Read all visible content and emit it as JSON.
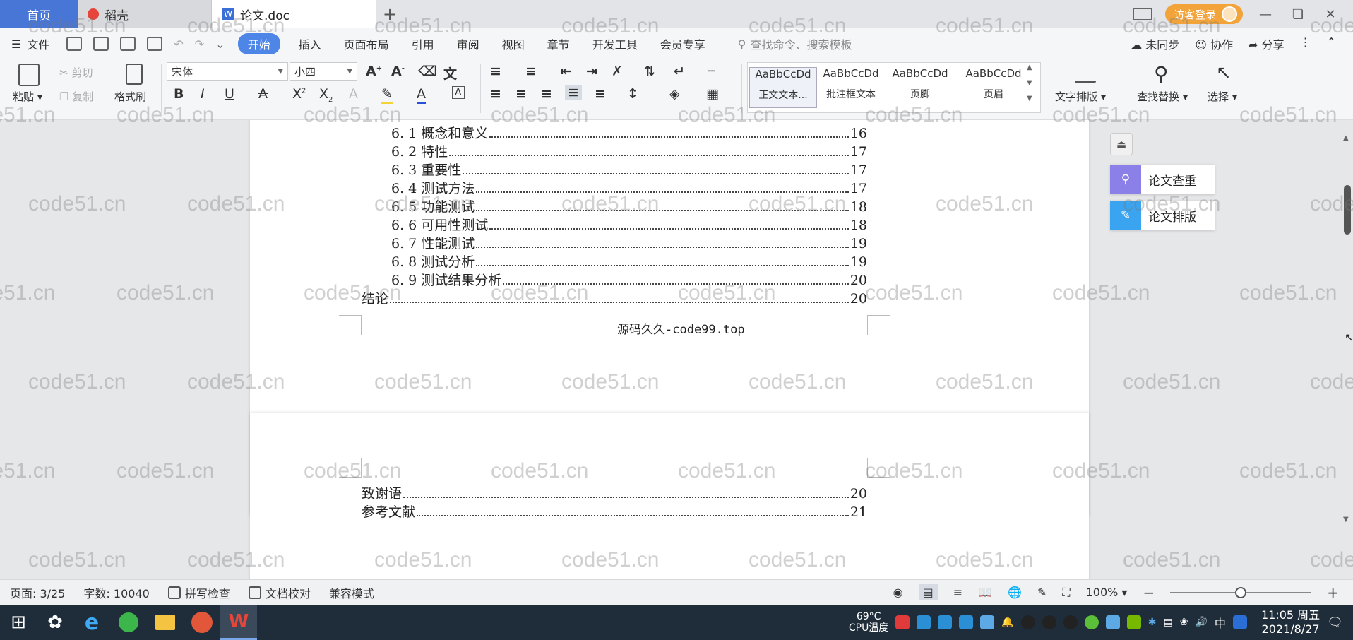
{
  "titlebar": {
    "tab_home": "首页",
    "tab_daoke": "稻壳",
    "tab_doc": "论文.doc",
    "tab_add": "+",
    "login": "访客登录"
  },
  "menu": {
    "file": "文件",
    "items": [
      "开始",
      "插入",
      "页面布局",
      "引用",
      "审阅",
      "视图",
      "章节",
      "开发工具",
      "会员专享"
    ],
    "search_placeholder": "查找命令、搜索模板",
    "right": [
      "未同步",
      "协作",
      "分享"
    ]
  },
  "ribbon": {
    "paste": "粘贴",
    "cut": "剪切",
    "copy": "复制",
    "format_painter": "格式刷",
    "font_name": "宋体",
    "font_size": "小四",
    "styles": [
      {
        "preview": "AaBbCcDd",
        "name": "正文文本..."
      },
      {
        "preview": "AaBbCcDd",
        "name": "批注框文本"
      },
      {
        "preview": "AaBbCcDd",
        "name": "页脚"
      },
      {
        "preview": "AaBbCcDd",
        "name": "页眉"
      }
    ],
    "text_layout": "文字排版",
    "find_replace": "查找替换",
    "select": "选择"
  },
  "document": {
    "toc_page1": [
      {
        "label": "6. 1 概念和意义",
        "page": "16"
      },
      {
        "label": "6. 2 特性",
        "page": "17"
      },
      {
        "label": "6. 3 重要性",
        "page": "17"
      },
      {
        "label": "6. 4 测试方法",
        "page": "17"
      },
      {
        "label": "6. 5  功能测试",
        "page": "18"
      },
      {
        "label": "6. 6 可用性测试",
        "page": "18"
      },
      {
        "label": "6. 7 性能测试",
        "page": "19"
      },
      {
        "label": "6. 8 测试分析",
        "page": "19"
      },
      {
        "label": "6. 9 测试结果分析",
        "page": "20"
      },
      {
        "label": "结论",
        "page": "20"
      }
    ],
    "footer": "源码久久-code99.top",
    "toc_page2": [
      {
        "label": "致谢语",
        "page": "20"
      },
      {
        "label": "参考文献",
        "page": "21"
      }
    ]
  },
  "side_panel": {
    "check": "论文查重",
    "layout": "论文排版"
  },
  "statusbar": {
    "page": "页面: 3/25",
    "words": "字数: 10040",
    "spell": "拼写检查",
    "proof": "文档校对",
    "compat": "兼容模式",
    "zoom": "100%",
    "zoom_level": 0.5
  },
  "taskbar": {
    "cpu_temp": "69°C",
    "cpu_label": "CPU温度",
    "ime": "中",
    "time": "11:05 周五",
    "date": "2021/8/27"
  },
  "watermark": "code51.cn",
  "colors": {
    "accent": "#4d86e6",
    "login": "#f2a33a",
    "taskbar": "#1f2d3a"
  }
}
